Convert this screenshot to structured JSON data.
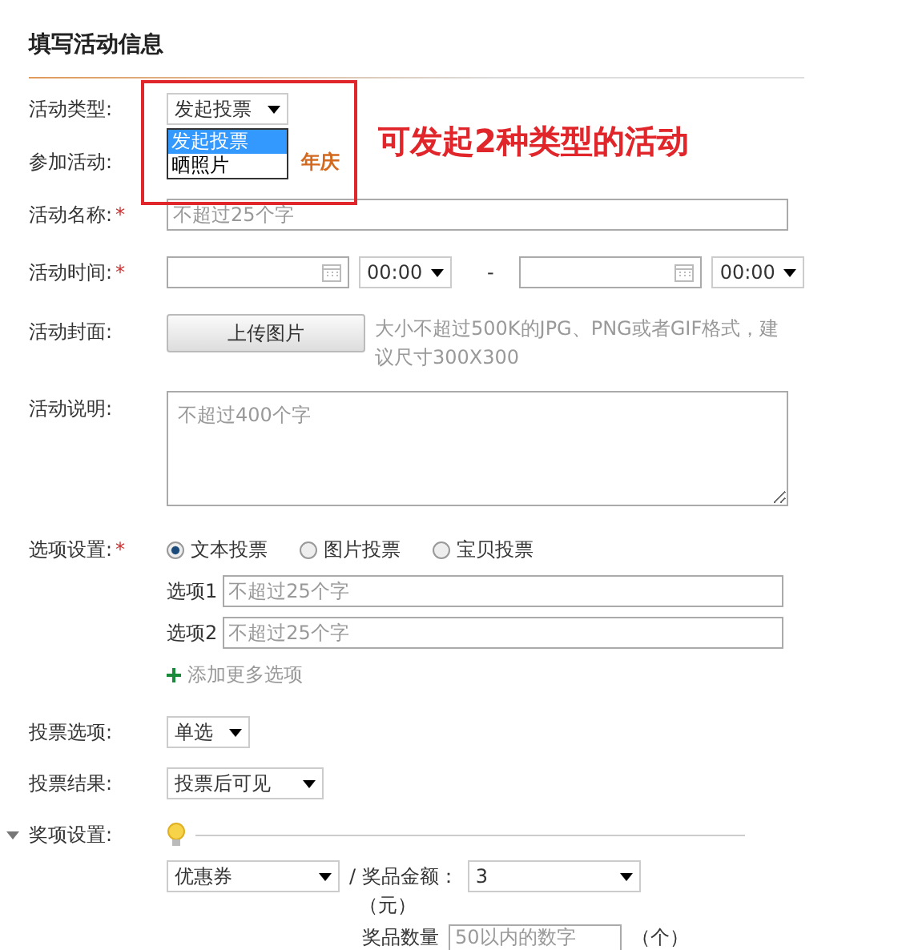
{
  "title": "填写活动信息",
  "fields": [
    {
      "kind": "select",
      "label": "活动类型:",
      "value": "发起投票",
      "options": [
        {
          "label": "发起投票",
          "selected": true
        },
        {
          "label": "晒照片",
          "selected": false
        }
      ]
    },
    {
      "kind": "text",
      "label": "参加活动:",
      "value": "年庆"
    },
    {
      "kind": "input",
      "label": "活动名称:",
      "required_mark": "*",
      "placeholder": "不超过25个字"
    },
    {
      "kind": "daterange",
      "label": "活动时间:",
      "required_mark": "*",
      "start_time": "00:00",
      "separator": "-",
      "end_time": "00:00"
    },
    {
      "kind": "upload",
      "label": "活动封面:",
      "button": "上传图片",
      "hint": "大小不超过500K的JPG、PNG或者GIF格式，建议尺寸300X300"
    },
    {
      "kind": "textarea",
      "label": "活动说明:",
      "placeholder": "不超过400个字"
    },
    {
      "kind": "options",
      "label": "选项设置:",
      "required_mark": "*",
      "types": [
        {
          "label": "文本投票",
          "selected": true
        },
        {
          "label": "图片投票",
          "selected": false
        },
        {
          "label": "宝贝投票",
          "selected": false
        }
      ],
      "items": [
        {
          "label": "选项1",
          "placeholder": "不超过25个字"
        },
        {
          "label": "选项2",
          "placeholder": "不超过25个字"
        }
      ],
      "add": "添加更多选项"
    },
    {
      "kind": "select",
      "label": "投票选项:",
      "value": "单选"
    },
    {
      "kind": "select",
      "label": "投票结果:",
      "value": "投票后可见"
    },
    {
      "kind": "prize",
      "label": "奖项设置:",
      "expanded": true,
      "prize_type": "优惠券",
      "amount_label": "/ 奖品金额：",
      "amount": "3",
      "unit": "（元）",
      "count_label": "奖品数量",
      "count_placeholder": "50以内的数字",
      "count_unit": "（个）"
    }
  ],
  "annotation": "可发起2种类型的活动"
}
